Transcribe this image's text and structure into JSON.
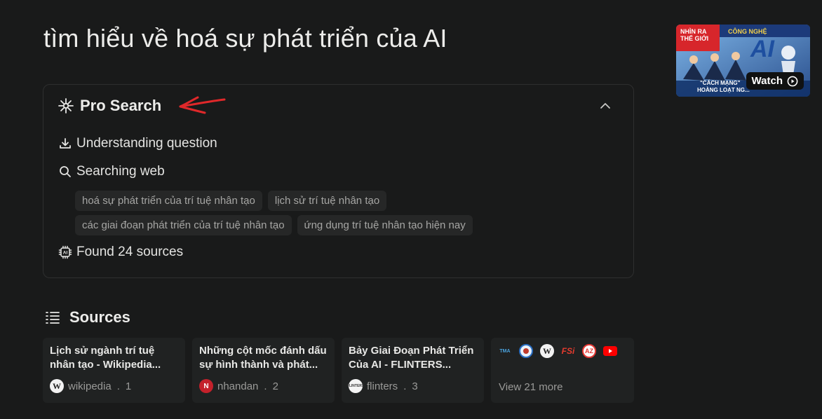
{
  "query": "tìm hiểu về hoá sự phát triển của AI",
  "pro_search": {
    "label": "Pro Search",
    "steps": {
      "understanding": "Understanding question",
      "searching": "Searching web",
      "found": "Found 24 sources"
    },
    "queries_row1": [
      "hoá sự phát triển của trí tuệ nhân tạo",
      "lịch sử trí tuệ nhân tạo"
    ],
    "queries_row2": [
      "các giai đoạn phát triển của trí tuệ nhân tạo",
      "ứng dụng trí tuệ nhân tạo hiện nay"
    ]
  },
  "sources": {
    "label": "Sources",
    "cards": [
      {
        "title": "Lịch sử ngành trí tuệ nhân tạo - Wikipedia...",
        "site": "wikipedia",
        "index": "1",
        "icon": "wikipedia-icon"
      },
      {
        "title": "Những cột mốc đánh dấu sự hình thành và phát...",
        "site": "nhandan",
        "index": "2",
        "icon": "nhandan-icon"
      },
      {
        "title": "Bảy Giai Đoạn Phát Triển Của AI - FLINTERS...",
        "site": "flinters",
        "index": "3",
        "icon": "flinters-icon"
      }
    ],
    "more_label": "View 21 more"
  },
  "video": {
    "watch_label": "Watch",
    "thumb_text_1": "NHÌN RA THẾ GIỚI",
    "thumb_text_2": "CÔNG NGHỆ",
    "thumb_text_3": "AI",
    "thumb_text_4": "\"CÁCH MẠNG\"",
    "thumb_text_5": "HOÀNG LOẠT NG..."
  },
  "colors": {
    "background": "#191a1a",
    "panel_border": "#2e2f2f",
    "chip_bg": "#262727",
    "card_bg": "#202222",
    "annotation_arrow": "#e0282a"
  }
}
